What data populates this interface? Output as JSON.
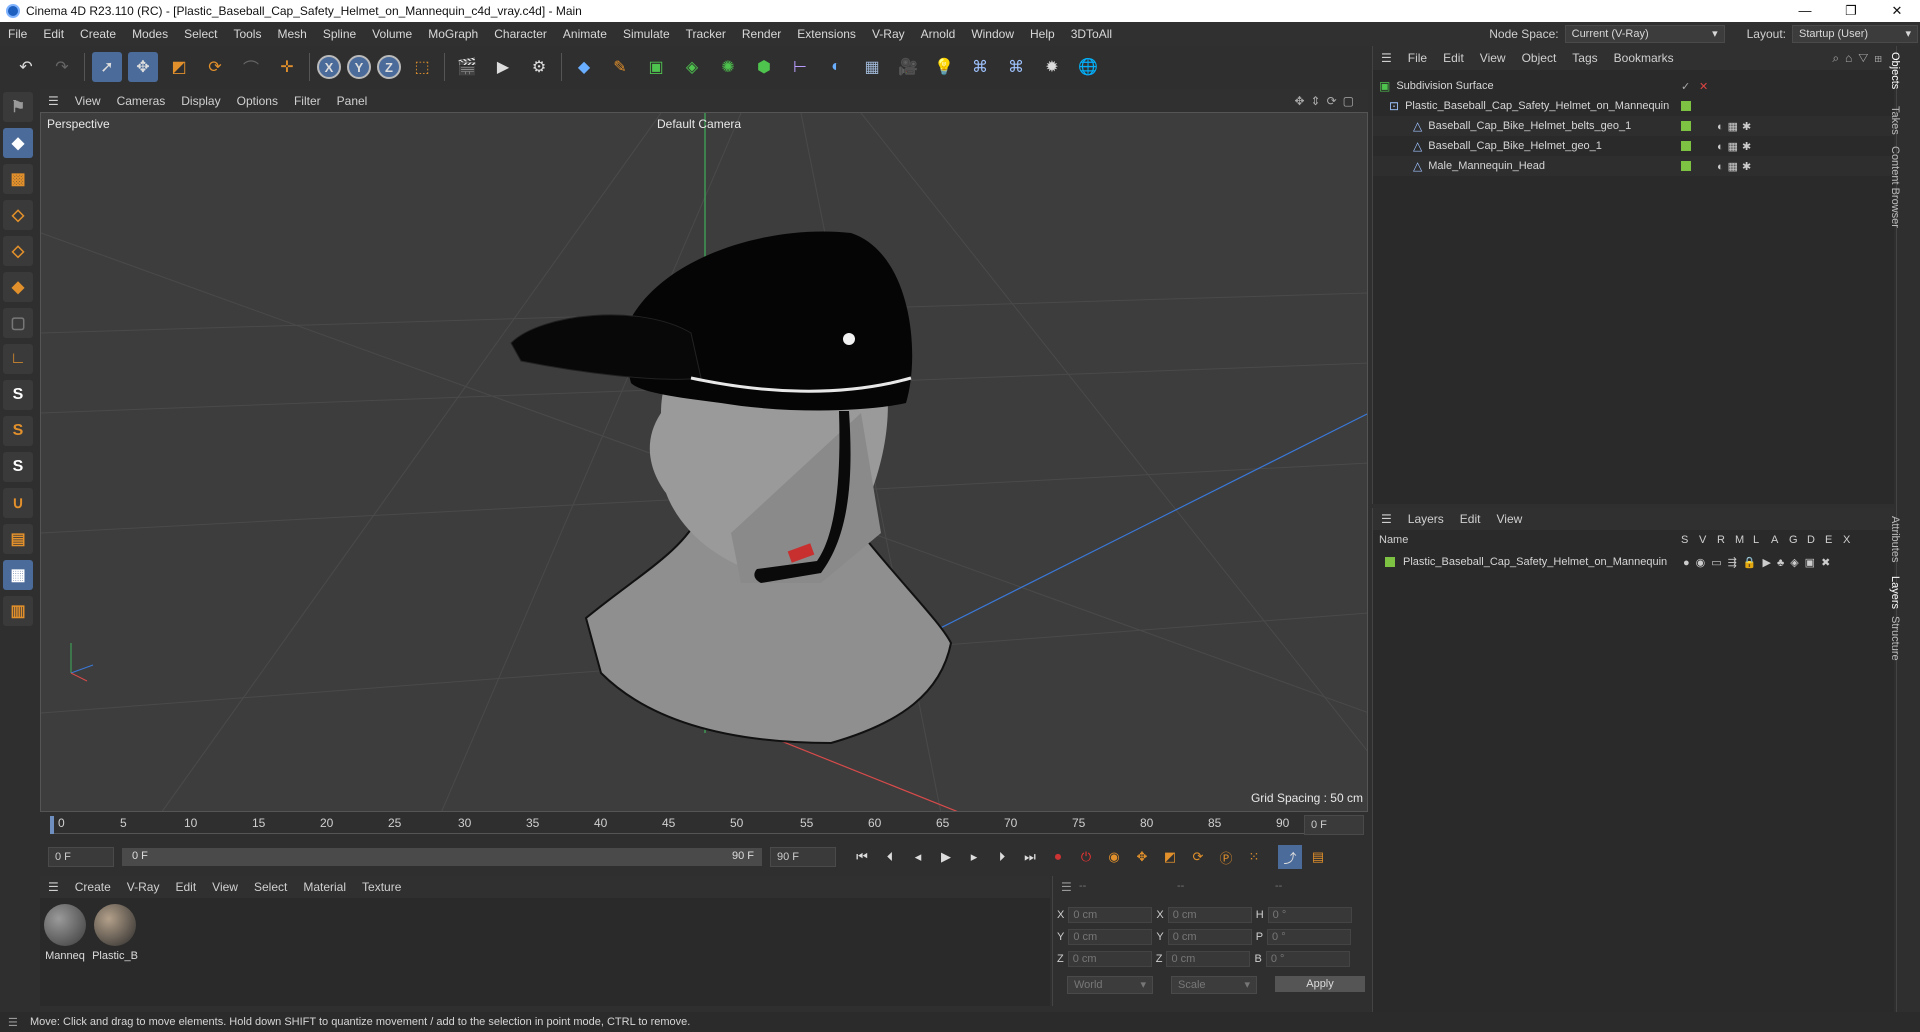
{
  "window": {
    "title": "Cinema 4D R23.110 (RC) - [Plastic_Baseball_Cap_Safety_Helmet_on_Mannequin_c4d_vray.c4d] - Main",
    "controls": [
      "—",
      "❐",
      "✕"
    ]
  },
  "menubar": {
    "items": [
      "File",
      "Edit",
      "Create",
      "Modes",
      "Select",
      "Tools",
      "Mesh",
      "Spline",
      "Volume",
      "MoGraph",
      "Character",
      "Animate",
      "Simulate",
      "Tracker",
      "Render",
      "Extensions",
      "V-Ray",
      "Arnold",
      "Window",
      "Help",
      "3DToAll"
    ],
    "node_space_label": "Node Space:",
    "node_space_value": "Current (V-Ray)",
    "layout_label": "Layout:",
    "layout_value": "Startup (User)"
  },
  "viewport": {
    "menu": [
      "View",
      "Cameras",
      "Display",
      "Options",
      "Filter",
      "Panel"
    ],
    "view_name": "Perspective",
    "camera": "Default Camera",
    "grid_spacing": "Grid Spacing : 50 cm"
  },
  "timeline": {
    "ticks": [
      "0",
      "5",
      "10",
      "15",
      "20",
      "25",
      "30",
      "35",
      "40",
      "45",
      "50",
      "55",
      "60",
      "65",
      "70",
      "75",
      "80",
      "85",
      "90"
    ],
    "current_frame": "0 F",
    "start_field": "0 F",
    "range_start": "0 F",
    "range_end": "90 F",
    "end_field": "90 F"
  },
  "materials": {
    "menu": [
      "Create",
      "V-Ray",
      "Edit",
      "View",
      "Select",
      "Material",
      "Texture"
    ],
    "items": [
      {
        "name": "Manneq",
        "color": "#555555"
      },
      {
        "name": "Plastic_B",
        "color": "#6b5a48"
      }
    ]
  },
  "coordinates": {
    "header": [
      "--",
      "--",
      "--"
    ],
    "rows": [
      {
        "axis": "X",
        "pos": "0 cm",
        "axis2": "X",
        "size": "0 cm",
        "rot_axis": "H",
        "rot": "0 °"
      },
      {
        "axis": "Y",
        "pos": "0 cm",
        "axis2": "Y",
        "size": "0 cm",
        "rot_axis": "P",
        "rot": "0 °"
      },
      {
        "axis": "Z",
        "pos": "0 cm",
        "axis2": "Z",
        "size": "0 cm",
        "rot_axis": "B",
        "rot": "0 °"
      }
    ],
    "world": "World",
    "scale": "Scale",
    "apply": "Apply"
  },
  "objects_panel": {
    "menu": [
      "File",
      "Edit",
      "View",
      "Object",
      "Tags",
      "Bookmarks"
    ],
    "items": [
      {
        "name": "Subdivision Surface",
        "icon": "subdivision-icon"
      },
      {
        "name": "Plastic_Baseball_Cap_Safety_Helmet_on_Mannequin",
        "icon": "null-icon"
      },
      {
        "name": "Baseball_Cap_Bike_Helmet_belts_geo_1",
        "icon": "polygon-icon"
      },
      {
        "name": "Baseball_Cap_Bike_Helmet_geo_1",
        "icon": "polygon-icon"
      },
      {
        "name": "Male_Mannequin_Head",
        "icon": "polygon-icon"
      }
    ]
  },
  "layers_panel": {
    "menu": [
      "Layers",
      "Edit",
      "View"
    ],
    "columns": [
      "Name",
      "S",
      "V",
      "R",
      "M",
      "L",
      "A",
      "G",
      "D",
      "E",
      "X"
    ],
    "items": [
      {
        "name": "Plastic_Baseball_Cap_Safety_Helmet_on_Mannequin",
        "color": "#7dc243"
      }
    ]
  },
  "side_tabs": [
    "Objects",
    "Takes",
    "Content Browser",
    "Attributes",
    "Layers",
    "Structure"
  ],
  "status": "Move: Click and drag to move elements. Hold down SHIFT to quantize movement / add to the selection in point mode, CTRL to remove."
}
